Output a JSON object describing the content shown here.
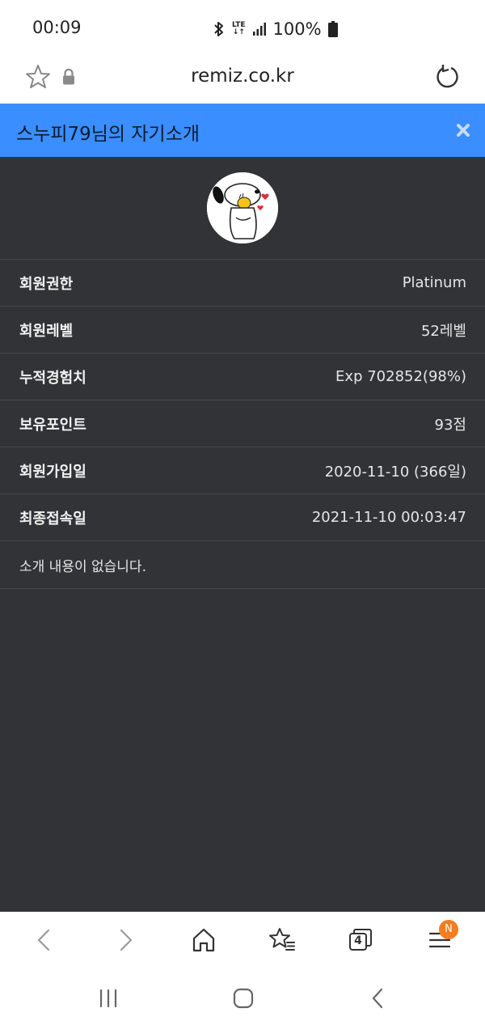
{
  "status_bar": {
    "time": "00:09",
    "network": "LTE",
    "battery": "100%"
  },
  "address_bar": {
    "url": "remiz.co.kr"
  },
  "dialog": {
    "title": "스누피79님의 자기소개",
    "accent_color": "#3a8eff",
    "background_color": "#323336",
    "rows": [
      {
        "label": "회원권한",
        "value": "Platinum"
      },
      {
        "label": "회원레벨",
        "value": "52레벨"
      },
      {
        "label": "누적경험치",
        "value": "Exp 702852(98%)"
      },
      {
        "label": "보유포인트",
        "value": "93점"
      },
      {
        "label": "회원가입일",
        "value": "2020-11-10 (366일)"
      },
      {
        "label": "최종접속일",
        "value": "2021-11-10 00:03:47"
      }
    ],
    "intro": "소개 내용이 없습니다."
  },
  "browser_toolbar": {
    "tabs_count": "4",
    "menu_badge": "N",
    "badge_color": "#f57c1f"
  }
}
